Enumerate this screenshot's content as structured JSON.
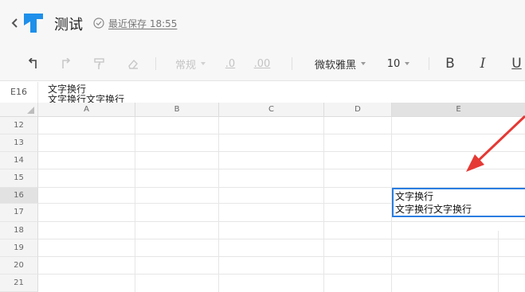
{
  "header": {
    "title": "测试",
    "save_status": "最近保存 18:55"
  },
  "toolbar": {
    "number_format": "常规",
    "decimal_decrease": ".0",
    "decimal_increase": ".00",
    "font_name": "微软雅黑",
    "font_size": "10",
    "bold": "B",
    "italic": "I",
    "underline": "U"
  },
  "formula_bar": {
    "cell_ref": "E16",
    "line1": "文字换行",
    "line2": "文字换行文字换行"
  },
  "columns": [
    "A",
    "B",
    "C",
    "D",
    "E"
  ],
  "rows": [
    "12",
    "13",
    "14",
    "15",
    "16",
    "17",
    "18",
    "19",
    "20",
    "21"
  ],
  "selected_cell": {
    "column": "E",
    "row": "16",
    "line1": "文字换行",
    "line2": "文字换行文字换行"
  },
  "colors": {
    "selection": "#2a7de1",
    "arrow": "#e53935",
    "logo": "#1e8fea"
  }
}
